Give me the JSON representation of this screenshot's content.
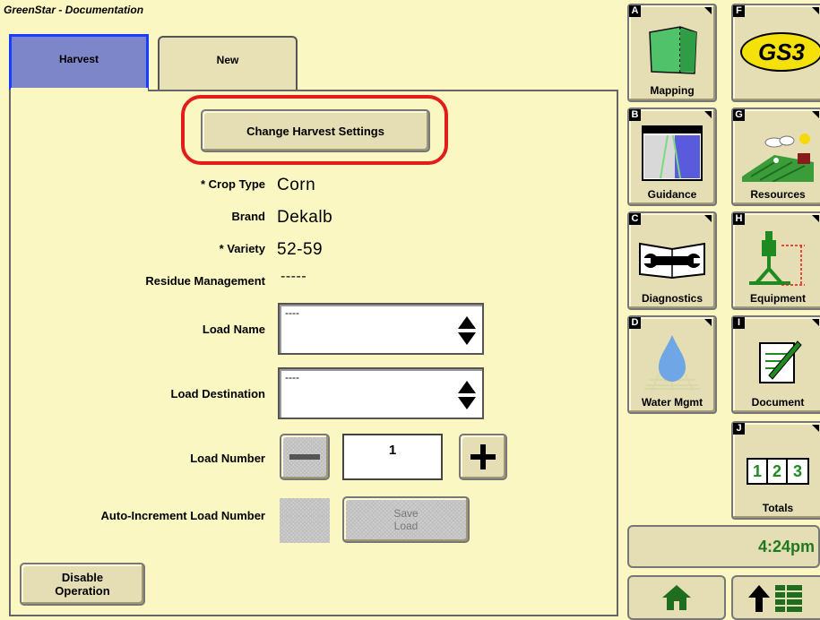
{
  "header": {
    "title": "GreenStar - Documentation"
  },
  "tabs": [
    {
      "label": "Harvest",
      "active": true
    },
    {
      "label": "New",
      "active": false
    }
  ],
  "main": {
    "change_settings_label": "Change Harvest Settings",
    "crop_type": {
      "label": "* Crop Type",
      "value": "Corn"
    },
    "brand": {
      "label": "Brand",
      "value": "Dekalb"
    },
    "variety": {
      "label": "* Variety",
      "value": "52-59"
    },
    "residue": {
      "label": "Residue Management",
      "value": "-----"
    },
    "load_name": {
      "label": "Load Name",
      "value": "----"
    },
    "load_destination": {
      "label": "Load Destination",
      "value": "----"
    },
    "load_number": {
      "label": "Load Number",
      "value": "1"
    },
    "auto_increment": {
      "label": "Auto-Increment Load Number"
    },
    "save_load": {
      "line1": "Save",
      "line2": "Load"
    },
    "disable_operation": {
      "line1": "Disable",
      "line2": "Operation"
    }
  },
  "softkeys": [
    {
      "letter": "A",
      "label": "Mapping",
      "icon": "field-map-icon"
    },
    {
      "letter": "F",
      "label": "",
      "icon": "gs3-logo",
      "logo_text": "GS3"
    },
    {
      "letter": "B",
      "label": "Guidance",
      "icon": "guidance-icon"
    },
    {
      "letter": "G",
      "label": "Resources",
      "icon": "resources-icon"
    },
    {
      "letter": "C",
      "label": "Diagnostics",
      "icon": "wrench-book-icon"
    },
    {
      "letter": "H",
      "label": "Equipment",
      "icon": "equipment-icon"
    },
    {
      "letter": "D",
      "label": "Water Mgmt",
      "icon": "water-drop-icon"
    },
    {
      "letter": "I",
      "label": "Document",
      "icon": "document-icon"
    },
    {
      "letter": "J",
      "label": "Totals",
      "icon": "totals-icon",
      "digits": [
        "1",
        "2",
        "3"
      ]
    }
  ],
  "status": {
    "time": "4:24pm"
  },
  "colors": {
    "background": "#fbf7c2",
    "button": "#e5ddb4",
    "active_tab": "#7d86c9",
    "highlight": "#e21b1b",
    "clock": "#1f7a1f"
  }
}
